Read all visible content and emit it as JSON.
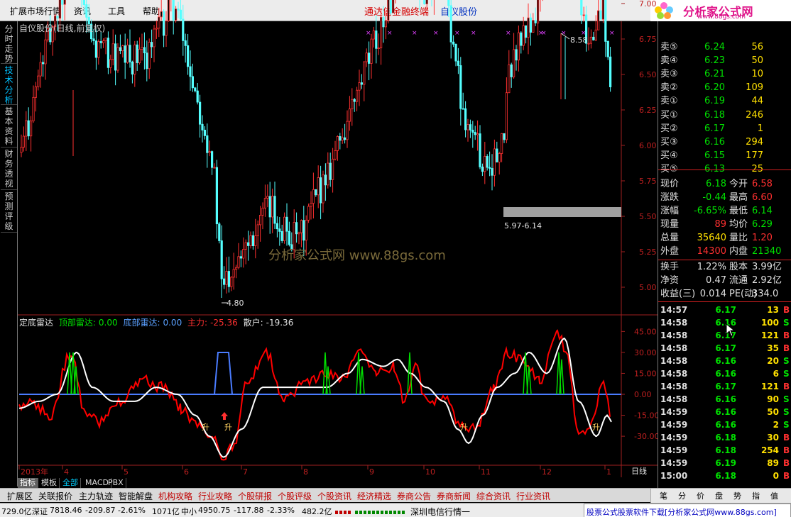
{
  "menu": [
    "扩展市场行情",
    "资讯",
    "工具",
    "帮助"
  ],
  "header": {
    "terminal": "通达信金融终端",
    "stock": "自仪股份"
  },
  "logo": {
    "brand": "分析家公式网",
    "url": "www.88gs.com",
    "settings": "设置"
  },
  "left_tabs": [
    "分时走势",
    "技术分析",
    "基本资料",
    "财务透视",
    "预测评级"
  ],
  "chart": {
    "title": "自仪股份(日线,前复权)",
    "price_ticks": [
      "8.50",
      "8.25",
      "8.00",
      "7.75",
      "7.50",
      "7.25",
      "7.00",
      "6.75",
      "6.50",
      "6.25",
      "6.00",
      "5.75",
      "5.50",
      "5.25",
      "5.00"
    ],
    "high_label": "8.58",
    "low_label": "4.80",
    "range_label": "5.97-6.14",
    "watermark": "分析家公式网 www.88gs.com",
    "x_labels": [
      "2013年",
      "4",
      "5",
      "6",
      "7",
      "8",
      "9",
      "10",
      "11",
      "12",
      "1"
    ],
    "period": "日线"
  },
  "indicator": {
    "name": "定底雷达",
    "top_label": "顶部雷达:",
    "top_val": "0.00",
    "bottom_label": "底部雷达:",
    "bottom_val": "0.00",
    "main_label": "主力:",
    "main_val": "-25.36",
    "retail_label": "散户:",
    "retail_val": "-19.36",
    "ticks": [
      "45.00",
      "30.00",
      "15.00",
      "0.00",
      "-15.00",
      "-30.00"
    ],
    "rise_marker": "升"
  },
  "chart_data": {
    "type": "line",
    "title": "定底雷达",
    "series": [
      {
        "name": "主力",
        "color": "#ff0000"
      },
      {
        "name": "散户",
        "color": "#ffffff"
      }
    ],
    "ylim": [
      -45,
      50
    ]
  },
  "tabs": [
    "指标",
    "模板",
    "全部",
    "MACD",
    "PBX"
  ],
  "func_bar": [
    "扩展区",
    "关联报价",
    "主力轨迹",
    "智能解盘",
    "机构攻略",
    "行业攻略",
    "个股研报",
    "个股评级",
    "个股资讯",
    "经济精选",
    "券商公告",
    "券商新闻",
    "综合资讯",
    "行业资讯"
  ],
  "status": {
    "amount1": "729.0亿",
    "sz_label": "深证",
    "sz_val": "7818.46",
    "sz_chg": "-209.87",
    "sz_pct": "-2.61%",
    "sz_amt": "1071亿",
    "zx_label": "中小",
    "zx_val": "4950.75",
    "zx_chg": "-117.88",
    "zx_pct": "-2.33%",
    "zx_amt": "482.2亿",
    "feed": "深圳电信行情一",
    "ad": "股票公式股票软件下载[分析家公式网www.88gs.com]"
  },
  "orderbook": {
    "asks": [
      {
        "label": "卖⑤",
        "price": "6.24",
        "vol": "56"
      },
      {
        "label": "卖④",
        "price": "6.23",
        "vol": "50"
      },
      {
        "label": "卖③",
        "price": "6.21",
        "vol": "10"
      },
      {
        "label": "卖②",
        "price": "6.20",
        "vol": "109"
      },
      {
        "label": "卖①",
        "price": "6.19",
        "vol": "44"
      }
    ],
    "bids": [
      {
        "label": "买①",
        "price": "6.18",
        "vol": "246"
      },
      {
        "label": "买②",
        "price": "6.17",
        "vol": "1"
      },
      {
        "label": "买③",
        "price": "6.16",
        "vol": "294"
      },
      {
        "label": "买④",
        "price": "6.15",
        "vol": "177"
      },
      {
        "label": "买⑤",
        "price": "6.13",
        "vol": "25"
      }
    ]
  },
  "quote": [
    {
      "l1": "现价",
      "v1": "6.18",
      "l2": "今开",
      "v2": "6.58",
      "c1": "cg",
      "c2": "cr"
    },
    {
      "l1": "涨跌",
      "v1": "-0.44",
      "l2": "最高",
      "v2": "6.60",
      "c1": "cg",
      "c2": "cr"
    },
    {
      "l1": "涨幅",
      "v1": "-6.65%",
      "l2": "最低",
      "v2": "6.14",
      "c1": "cg",
      "c2": "cg"
    },
    {
      "l1": "现量",
      "v1": "89",
      "l2": "均价",
      "v2": "6.29",
      "c1": "cr",
      "c2": "cg"
    },
    {
      "l1": "总量",
      "v1": "35640",
      "l2": "量比",
      "v2": "1.20",
      "c1": "cy",
      "c2": "cr"
    },
    {
      "l1": "外盘",
      "v1": "14300",
      "l2": "内盘",
      "v2": "21340",
      "c1": "cr",
      "c2": "cg"
    }
  ],
  "fundamentals": [
    {
      "l1": "换手",
      "v1": "1.22%",
      "l2": "股本",
      "v2": "3.99亿"
    },
    {
      "l1": "净资",
      "v1": "0.47",
      "l2": "流通",
      "v2": "2.92亿"
    },
    {
      "l1": "收益(三)",
      "v1": "0.014",
      "l2": "PE(动)",
      "v2": "334.0"
    }
  ],
  "ticks": [
    {
      "t": "14:57",
      "p": "6.17",
      "v": "13",
      "d": "B"
    },
    {
      "t": "14:58",
      "p": "6.16",
      "v": "100",
      "d": "S"
    },
    {
      "t": "14:58",
      "p": "6.17",
      "v": "121",
      "d": "B"
    },
    {
      "t": "14:58",
      "p": "6.17",
      "v": "35",
      "d": "B"
    },
    {
      "t": "14:58",
      "p": "6.16",
      "v": "20",
      "d": "S"
    },
    {
      "t": "14:58",
      "p": "6.16",
      "v": "6",
      "d": "S"
    },
    {
      "t": "14:58",
      "p": "6.17",
      "v": "121",
      "d": "B"
    },
    {
      "t": "14:58",
      "p": "6.16",
      "v": "90",
      "d": "S"
    },
    {
      "t": "14:59",
      "p": "6.16",
      "v": "50",
      "d": "S"
    },
    {
      "t": "14:59",
      "p": "6.16",
      "v": "2",
      "d": "S"
    },
    {
      "t": "14:59",
      "p": "6.18",
      "v": "30",
      "d": "B"
    },
    {
      "t": "14:59",
      "p": "6.18",
      "v": "254",
      "d": "B"
    },
    {
      "t": "14:59",
      "p": "6.19",
      "v": "89",
      "d": "B"
    },
    {
      "t": "15:00",
      "p": "6.18",
      "v": "0",
      "d": "B"
    }
  ],
  "panel_tabs": [
    "笔",
    "分",
    "价",
    "盘",
    "势",
    "指",
    "值"
  ]
}
